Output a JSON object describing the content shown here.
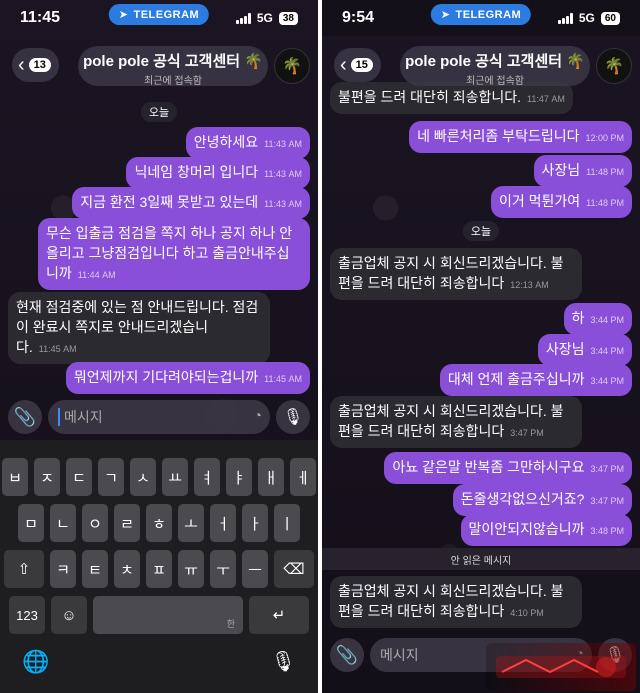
{
  "left": {
    "status": {
      "time": "11:45",
      "network": "5G",
      "battery": "38"
    },
    "telegram_label": "TELEGRAM",
    "header": {
      "back_count": "13",
      "title": "pole pole 공식 고객센터",
      "subtitle": "최근에 접속함"
    },
    "date_label": "오늘",
    "messages": [
      {
        "dir": "out",
        "text": "안녕하세요",
        "time": "11:43 AM"
      },
      {
        "dir": "out",
        "text": "닉네임 창머리 입니다",
        "time": "11:43 AM"
      },
      {
        "dir": "out",
        "text": "지금 환전 3일째 못받고 있는데",
        "time": "11:43 AM"
      },
      {
        "dir": "out",
        "text": "무슨 입출금 점검을 쪽지 하나 공지 하나 안올리고 그냥점검입니다 하고 출금안내주십니까",
        "time": "11:44 AM"
      },
      {
        "dir": "in",
        "text": "현재 점검중에 있는 점 안내드립니다. 점검이 완료시 쪽지로 안내드리겠습니다.",
        "time": "11:45 AM"
      },
      {
        "dir": "out",
        "text": "뭐언제까지 기다려야되는겁니까",
        "time": "11:45 AM"
      }
    ],
    "input_placeholder": "메시지",
    "keyboard": {
      "row1": [
        "ㅂ",
        "ㅈ",
        "ㄷ",
        "ㄱ",
        "ㅅ",
        "ㅛ",
        "ㅕ",
        "ㅑ",
        "ㅐ",
        "ㅔ"
      ],
      "row2": [
        "ㅁ",
        "ㄴ",
        "ㅇ",
        "ㄹ",
        "ㅎ",
        "ㅗ",
        "ㅓ",
        "ㅏ",
        "ㅣ"
      ],
      "row3": [
        "ㅋ",
        "ㅌ",
        "ㅊ",
        "ㅍ",
        "ㅠ",
        "ㅜ",
        "ㅡ"
      ],
      "num_key": "123",
      "space_hint": "한"
    }
  },
  "right": {
    "status": {
      "time": "9:54",
      "network": "5G",
      "battery": "60"
    },
    "telegram_label": "TELEGRAM",
    "header": {
      "back_count": "15",
      "title": "pole pole 공식 고객센터",
      "subtitle": "최근에 접속함"
    },
    "messages_top": [
      {
        "dir": "in",
        "text": "불편을 드려 대단히 죄송합니다.",
        "time": "11:47 AM"
      },
      {
        "dir": "out",
        "text": "네 빠른처리좀 부탁드립니다",
        "time": "12:00 PM"
      },
      {
        "dir": "out",
        "text": "사장님",
        "time": "11:48 PM"
      },
      {
        "dir": "out",
        "text": "이거 먹튄가여",
        "time": "11:48 PM"
      }
    ],
    "date_label": "오늘",
    "messages": [
      {
        "dir": "in",
        "text": "출금업체 공지 시 회신드리겠습니다. 불편을 드려 대단히 죄송합니다",
        "time": "12:13 AM"
      },
      {
        "dir": "out",
        "text": "하",
        "time": "3:44 PM"
      },
      {
        "dir": "out",
        "text": "사장님",
        "time": "3:44 PM"
      },
      {
        "dir": "out",
        "text": "대체 언제 출금주십니까",
        "time": "3:44 PM"
      },
      {
        "dir": "in",
        "text": "출금업체 공지 시 회신드리겠습니다. 불편을 드려 대단히 죄송합니다",
        "time": "3:47 PM"
      },
      {
        "dir": "out",
        "text": "아뇨 같은말 반복좀 그만하시구요",
        "time": "3:47 PM"
      },
      {
        "dir": "out",
        "text": "돈줄생각없으신거죠?",
        "time": "3:47 PM"
      },
      {
        "dir": "out",
        "text": "말이안되지않습니까",
        "time": "3:48 PM"
      }
    ],
    "unread_label": "안 읽은 메시지",
    "last_message": {
      "dir": "in",
      "text": "출금업체 공지 시 회신드리겠습니다. 불편을 드려 대단히 죄송합니다",
      "time": "4:10 PM"
    },
    "input_placeholder": "메시지"
  }
}
